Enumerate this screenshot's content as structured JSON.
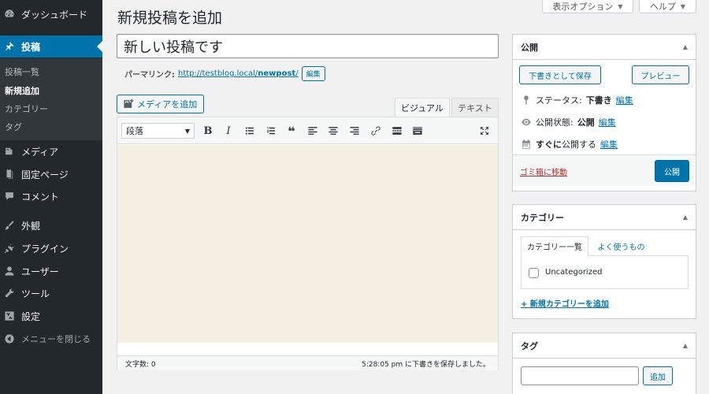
{
  "sidebar": {
    "items": [
      {
        "label": "ダッシュボード",
        "icon": "dashboard-icon"
      },
      {
        "label": "投稿",
        "icon": "pin-icon"
      },
      {
        "label": "メディア",
        "icon": "media-icon"
      },
      {
        "label": "固定ページ",
        "icon": "page-icon"
      },
      {
        "label": "コメント",
        "icon": "comment-icon"
      },
      {
        "label": "外観",
        "icon": "brush-icon"
      },
      {
        "label": "プラグイン",
        "icon": "plugin-icon"
      },
      {
        "label": "ユーザー",
        "icon": "user-icon"
      },
      {
        "label": "ツール",
        "icon": "wrench-icon"
      },
      {
        "label": "設定",
        "icon": "settings-icon"
      },
      {
        "label": "メニューを閉じる",
        "icon": "collapse-icon"
      }
    ],
    "submenu": [
      "投稿一覧",
      "新規追加",
      "カテゴリー",
      "タグ"
    ]
  },
  "header": {
    "title": "新規投稿を追加",
    "screen_options": "表示オプション",
    "help": "ヘルプ"
  },
  "post": {
    "title": "新しい投稿です",
    "permalink_label": "パーマリンク:",
    "permalink_url_prefix": "http://testblog.local/",
    "permalink_slug": "newpost",
    "permalink_url_suffix": "/",
    "edit_label": "編集"
  },
  "editor": {
    "add_media": "メディアを追加",
    "tab_visual": "ビジュアル",
    "tab_text": "テキスト",
    "format_select": "段落",
    "word_count": "文字数: 0",
    "draft_saved": "5:28:05 pm に下書きを保存しました。"
  },
  "publish": {
    "title": "公開",
    "save_draft": "下書きとして保存",
    "preview": "プレビュー",
    "status_label": "ステータス:",
    "status_value": "下書き",
    "visibility_label": "公開状態:",
    "visibility_value": "公開",
    "schedule_bold": "すぐに",
    "schedule_rest": "公開する",
    "edit": "編集",
    "trash": "ゴミ箱に移動",
    "publish_button": "公開"
  },
  "categories": {
    "title": "カテゴリー",
    "tab_all": "カテゴリー一覧",
    "tab_popular": "よく使うもの",
    "items": [
      "Uncategorized"
    ],
    "add_new": "+ 新規カテゴリーを追加"
  },
  "tags": {
    "title": "タグ",
    "add_button": "追加"
  },
  "colors": {
    "admin_bar": "#23282d",
    "accent": "#0073aa",
    "editor_bg": "#f5efe1",
    "trash_red": "#b32d2e"
  }
}
